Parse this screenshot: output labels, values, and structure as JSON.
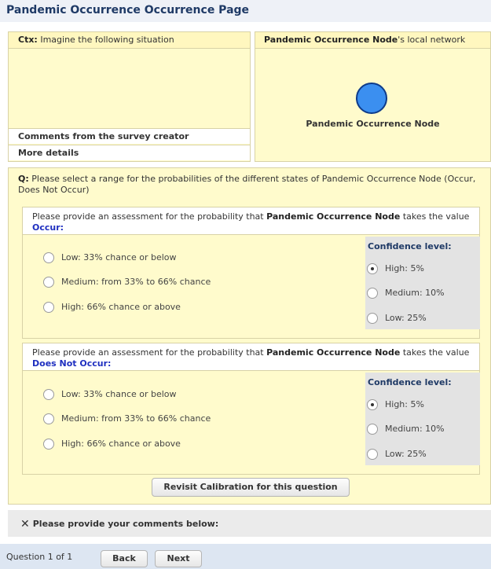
{
  "page": {
    "title": "Pandemic Occurrence Occurrence Page"
  },
  "context": {
    "label": "Ctx:",
    "text": "Imagine the following situation",
    "comments_label": "Comments from the survey creator",
    "details_label": "More details"
  },
  "network": {
    "node_name": "Pandemic Occurrence Node",
    "header_suffix": "'s local network",
    "node_label": "Pandemic Occurrence Node",
    "node_color": "#3b8ff0"
  },
  "question": {
    "label": "Q:",
    "text": "Please select a range for the probabilities of the different states of Pandemic Occurrence Node (Occur, Does Not Occur)"
  },
  "assessments": [
    {
      "prefix": "Please provide an assessment for the probability that",
      "node": "Pandemic Occurrence Node",
      "mid": "takes the value",
      "state": "Occur",
      "suffix": ":",
      "options": [
        "Low: 33% chance or below",
        "Medium: from 33% to 66% chance",
        "High: 66% chance or above"
      ],
      "confidence_title": "Confidence level:",
      "confidence": [
        "High: 5%",
        "Medium: 10%",
        "Low: 25%"
      ],
      "confidence_selected": "High: 5%"
    },
    {
      "prefix": "Please provide an assessment for the probability that",
      "node": "Pandemic Occurrence Node",
      "mid": "takes the value",
      "state": "Does Not Occur",
      "suffix": ":",
      "options": [
        "Low: 33% chance or below",
        "Medium: from 33% to 66% chance",
        "High: 66% chance or above"
      ],
      "confidence_title": "Confidence level:",
      "confidence": [
        "High: 5%",
        "Medium: 10%",
        "Low: 25%"
      ],
      "confidence_selected": "High: 5%"
    }
  ],
  "recalibrate_label": "Revisit Calibration for this question",
  "comments": {
    "icon": "close-icon",
    "label": "Please provide your comments below:"
  },
  "footer": {
    "question_count": "Question 1 of 1",
    "back_label": "Back",
    "next_label": "Next"
  }
}
